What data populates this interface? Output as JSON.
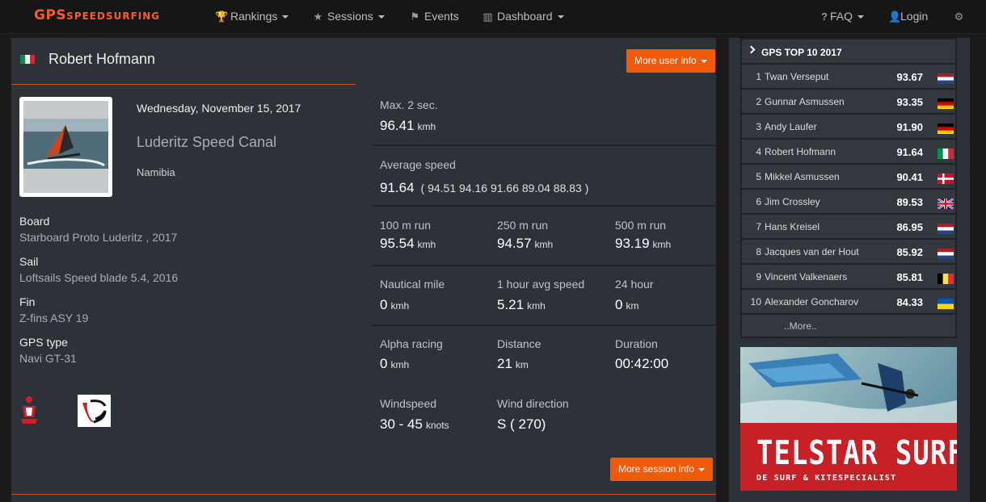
{
  "nav": {
    "brand_big": "GPS",
    "brand_small": "SPEEDSURFING",
    "rankings": "Rankings",
    "sessions": "Sessions",
    "events": "Events",
    "dashboard": "Dashboard",
    "faq": "FAQ",
    "login": "Login"
  },
  "user": {
    "name": "Robert Hofmann",
    "more_info_label": "More user info",
    "flag_colors": [
      "#009246",
      "#ffffff",
      "#ce2b37"
    ]
  },
  "session": {
    "date": "Wednesday, November 15, 2017",
    "spot": "Luderitz Speed Canal",
    "country": "Namibia",
    "more_info_label": "More session info"
  },
  "gear": [
    {
      "label": "Board",
      "value": "Starboard Proto Luderitz , 2017"
    },
    {
      "label": "Sail",
      "value": "Loftsails Speed blade 5.4, 2016"
    },
    {
      "label": "Fin",
      "value": "Z-fins ASY 19"
    },
    {
      "label": "GPS type",
      "value": "Navi GT-31"
    }
  ],
  "stats": {
    "max2": {
      "label": "Max. 2 sec.",
      "value": "96.41",
      "unit": "kmh"
    },
    "avg": {
      "label": "Average speed",
      "value": "91.64",
      "runs": "( 94.51 94.16 91.66 89.04 88.83 )"
    },
    "r100": {
      "label": "100 m run",
      "value": "95.54",
      "unit": "kmh"
    },
    "r250": {
      "label": "250 m run",
      "value": "94.57",
      "unit": "kmh"
    },
    "r500": {
      "label": "500 m run",
      "value": "93.19",
      "unit": "kmh"
    },
    "nautical": {
      "label": "Nautical mile",
      "value": "0",
      "unit": "kmh"
    },
    "hour": {
      "label": "1 hour avg speed",
      "value": "5.21",
      "unit": "kmh"
    },
    "h24": {
      "label": "24 hour",
      "value": "0",
      "unit": "km"
    },
    "alpha": {
      "label": "Alpha racing",
      "value": "0",
      "unit": "kmh"
    },
    "distance": {
      "label": "Distance",
      "value": "21",
      "unit": "km"
    },
    "duration": {
      "label": "Duration",
      "value": "00:42:00"
    },
    "windspeed": {
      "label": "Windspeed",
      "value": "30 - 45",
      "unit": "knots"
    },
    "winddir": {
      "label": "Wind direction",
      "value": "S ( 270)"
    }
  },
  "top10": {
    "title": "GPS TOP 10 2017",
    "more": "..More..",
    "rows": [
      {
        "rank": "1",
        "name": "Twan Verseput",
        "speed": "93.67",
        "country": "NL"
      },
      {
        "rank": "2",
        "name": "Gunnar Asmussen",
        "speed": "93.35",
        "country": "DE"
      },
      {
        "rank": "3",
        "name": "Andy Laufer",
        "speed": "91.90",
        "country": "DE"
      },
      {
        "rank": "4",
        "name": "Robert Hofmann",
        "speed": "91.64",
        "country": "IT"
      },
      {
        "rank": "5",
        "name": "Mikkel Asmussen",
        "speed": "90.41",
        "country": "DK"
      },
      {
        "rank": "6",
        "name": "Jim Crossley",
        "speed": "89.53",
        "country": "GB"
      },
      {
        "rank": "7",
        "name": "Hans Kreisel",
        "speed": "86.95",
        "country": "NL"
      },
      {
        "rank": "8",
        "name": "Jacques van der Hout",
        "speed": "85.92",
        "country": "NL"
      },
      {
        "rank": "9",
        "name": "Vincent Valkenaers",
        "speed": "85.81",
        "country": "BE"
      },
      {
        "rank": "10",
        "name": "Alexander Goncharov",
        "speed": "84.33",
        "country": "UA"
      }
    ]
  },
  "ad": {
    "brand": "TELSTAR SURF",
    "tagline": "DE SURF & KITESPECIALIST"
  },
  "colors": {
    "accent": "#f05a0a",
    "panel": "#2d3238",
    "background": "#1a1a1a"
  }
}
